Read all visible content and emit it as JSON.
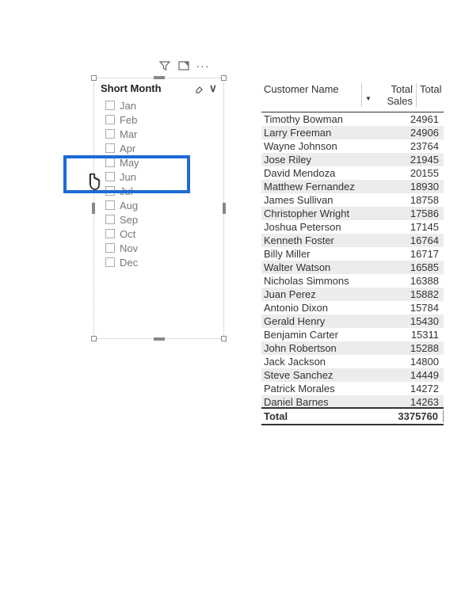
{
  "slicer": {
    "title": "Short Month",
    "items": [
      {
        "label": "Jan"
      },
      {
        "label": "Feb"
      },
      {
        "label": "Mar"
      },
      {
        "label": "Apr"
      },
      {
        "label": "May"
      },
      {
        "label": "Jun"
      },
      {
        "label": "Jul"
      },
      {
        "label": "Aug"
      },
      {
        "label": "Sep"
      },
      {
        "label": "Oct"
      },
      {
        "label": "Nov"
      },
      {
        "label": "Dec"
      }
    ]
  },
  "table": {
    "columns": {
      "name": "Customer Name",
      "sales": "Total Sales",
      "last": "Total"
    },
    "rows": [
      {
        "name": "Timothy Bowman",
        "sales": "24961"
      },
      {
        "name": "Larry Freeman",
        "sales": "24906"
      },
      {
        "name": "Wayne Johnson",
        "sales": "23764"
      },
      {
        "name": "Jose Riley",
        "sales": "21945"
      },
      {
        "name": "David Mendoza",
        "sales": "20155"
      },
      {
        "name": "Matthew Fernandez",
        "sales": "18930"
      },
      {
        "name": "James Sullivan",
        "sales": "18758"
      },
      {
        "name": "Christopher Wright",
        "sales": "17586"
      },
      {
        "name": "Joshua Peterson",
        "sales": "17145"
      },
      {
        "name": "Kenneth Foster",
        "sales": "16764"
      },
      {
        "name": "Billy Miller",
        "sales": "16717"
      },
      {
        "name": "Walter Watson",
        "sales": "16585"
      },
      {
        "name": "Nicholas Simmons",
        "sales": "16388"
      },
      {
        "name": "Juan Perez",
        "sales": "15882"
      },
      {
        "name": "Antonio Dixon",
        "sales": "15784"
      },
      {
        "name": "Gerald Henry",
        "sales": "15430"
      },
      {
        "name": "Benjamin Carter",
        "sales": "15311"
      },
      {
        "name": "John Robertson",
        "sales": "15288"
      },
      {
        "name": "Jack Jackson",
        "sales": "14800"
      },
      {
        "name": "Steve Sanchez",
        "sales": "14449"
      },
      {
        "name": "Patrick Morales",
        "sales": "14272"
      },
      {
        "name": "Daniel Barnes",
        "sales": "14263"
      }
    ],
    "total_label": "Total",
    "total_value": "3375760"
  }
}
